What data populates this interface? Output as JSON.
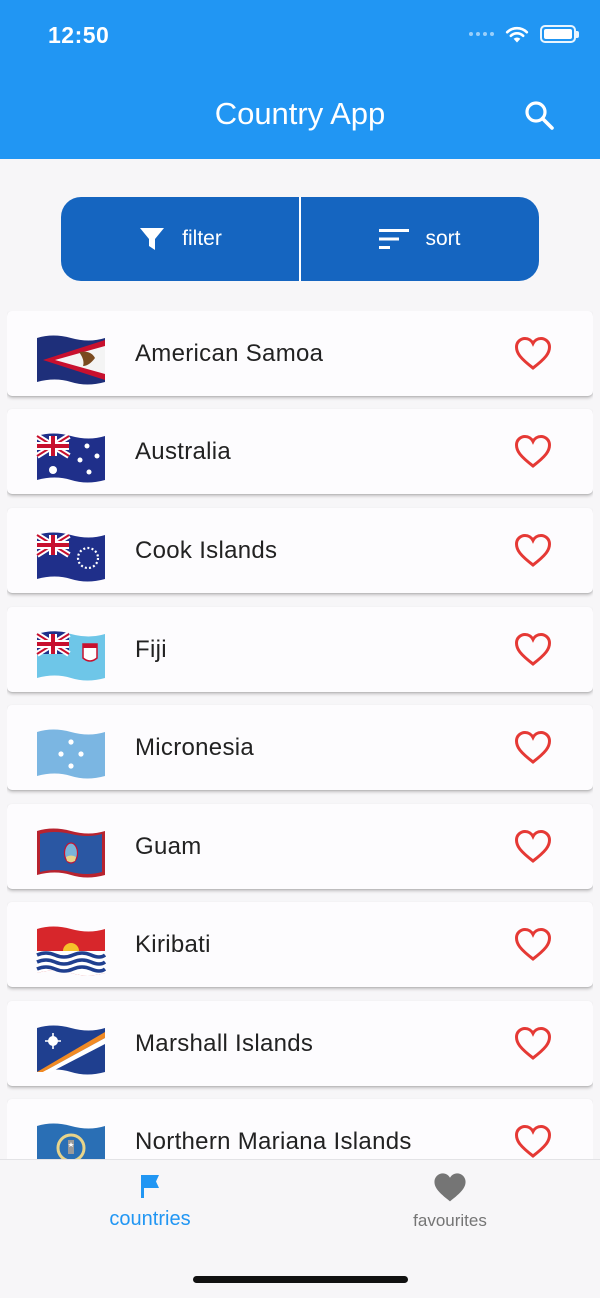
{
  "status_bar": {
    "time": "12:50"
  },
  "app_bar": {
    "title": "Country App",
    "search_icon": "search-icon"
  },
  "toolbar": {
    "filter_label": "filter",
    "sort_label": "sort"
  },
  "colors": {
    "primary": "#2196f3",
    "toolbar": "#1565c0",
    "heart": "#e53935"
  },
  "countries": [
    {
      "name": "American Samoa",
      "flag": "american-samoa-flag"
    },
    {
      "name": "Australia",
      "flag": "australia-flag"
    },
    {
      "name": "Cook Islands",
      "flag": "cook-islands-flag"
    },
    {
      "name": "Fiji",
      "flag": "fiji-flag"
    },
    {
      "name": "Micronesia",
      "flag": "micronesia-flag"
    },
    {
      "name": "Guam",
      "flag": "guam-flag"
    },
    {
      "name": "Kiribati",
      "flag": "kiribati-flag"
    },
    {
      "name": "Marshall Islands",
      "flag": "marshall-islands-flag"
    },
    {
      "name": "Northern Mariana Islands",
      "flag": "northern-mariana-islands-flag"
    }
  ],
  "bottom_nav": {
    "countries_label": "countries",
    "favourites_label": "favourites",
    "active": "countries"
  }
}
